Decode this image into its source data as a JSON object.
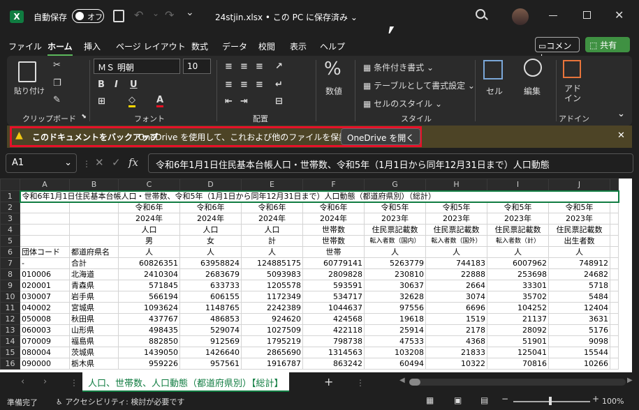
{
  "titlebar": {
    "app_icon": "X",
    "autosave_label": "自動保存",
    "autosave_state": "オフ",
    "file_title": "24stjin.xlsx • この PC に保存済み",
    "chevron": "⌄"
  },
  "menu": [
    "ファイル",
    "ホーム",
    "挿入",
    "ページ レイアウト",
    "数式",
    "データ",
    "校閲",
    "表示",
    "ヘルプ"
  ],
  "menu_active": "ホーム",
  "comment_button": "コメント",
  "share_button": "共有",
  "ribbon": {
    "paste_label": "貼り付け",
    "clipboard_label": "クリップボード",
    "font_name": "ＭＳ 明朝",
    "font_size": "10",
    "font_label": "フォント",
    "align_label": "配置",
    "number_label": "数値",
    "number_symbol": "%",
    "cond_format": "条件付き書式",
    "table_format": "テーブルとして書式設定",
    "cell_style": "セルのスタイル",
    "style_label": "スタイル",
    "cells_label": "セル",
    "edit_label": "編集",
    "addin_btn_1": "アド",
    "addin_btn_2": "イン",
    "addin_label": "アドイン"
  },
  "notification": {
    "title": "このドキュメントをバックアップ",
    "message": "OneDrive を使用して、これおよび他のファイルを保護します。",
    "button": "OneDrive を開く",
    "close": "✕"
  },
  "formula_bar": {
    "cell_ref": "A1",
    "fx": "fx",
    "content": "令和6年1月1日住民基本台帳人口・世帯数、令和5年（1月1日から同年12月31日まで）人口動態"
  },
  "columns": [
    "A",
    "B",
    "C",
    "D",
    "E",
    "F",
    "G",
    "H",
    "I",
    "J"
  ],
  "row_numbers": [
    "1",
    "2",
    "3",
    "4",
    "5",
    "6",
    "7",
    "8",
    "9",
    "10",
    "11",
    "12",
    "13",
    "14",
    "15",
    "16"
  ],
  "row1_text": "令和6年1月1日住民基本台帳人口・世帯数、令和5年（1月1日から同年12月31日まで）人口動態（都道府県別）（総計）",
  "header_rows": {
    "r2": [
      "",
      "",
      "令和6年",
      "令和6年",
      "令和6年",
      "令和6年",
      "令和5年",
      "令和5年",
      "令和5年",
      "令和5年"
    ],
    "r3": [
      "",
      "",
      "2024年",
      "2024年",
      "2024年",
      "2024年",
      "2023年",
      "2023年",
      "2023年",
      "2023年"
    ],
    "r4": [
      "",
      "",
      "人口",
      "人口",
      "人口",
      "世帯数",
      "住民票記載数",
      "住民票記載数",
      "住民票記載数",
      "住民票記載数"
    ],
    "r5": [
      "",
      "",
      "男",
      "女",
      "計",
      "世帯数",
      "転入者数（国内）",
      "転入者数（国外）",
      "転入者数（計）",
      "出生者数"
    ],
    "r6": [
      "団体コード",
      "都道府県名",
      "人",
      "人",
      "人",
      "世帯",
      "人",
      "人",
      "人",
      "人"
    ]
  },
  "data_rows": [
    [
      "-",
      "合計",
      "60826351",
      "63958824",
      "124885175",
      "60779141",
      "5263779",
      "744183",
      "6007962",
      "748912"
    ],
    [
      "010006",
      "北海道",
      "2410304",
      "2683679",
      "5093983",
      "2809828",
      "230810",
      "22888",
      "253698",
      "24682"
    ],
    [
      "020001",
      "青森県",
      "571845",
      "633733",
      "1205578",
      "593591",
      "30637",
      "2664",
      "33301",
      "5718"
    ],
    [
      "030007",
      "岩手県",
      "566194",
      "606155",
      "1172349",
      "534717",
      "32628",
      "3074",
      "35702",
      "5484"
    ],
    [
      "040002",
      "宮城県",
      "1093624",
      "1148765",
      "2242389",
      "1044637",
      "97556",
      "6696",
      "104252",
      "12404"
    ],
    [
      "050008",
      "秋田県",
      "437767",
      "486853",
      "924620",
      "424568",
      "19618",
      "1519",
      "21137",
      "3631"
    ],
    [
      "060003",
      "山形県",
      "498435",
      "529074",
      "1027509",
      "422118",
      "25914",
      "2178",
      "28092",
      "5176"
    ],
    [
      "070009",
      "福島県",
      "882850",
      "912569",
      "1795219",
      "798738",
      "47533",
      "4368",
      "51901",
      "9098"
    ],
    [
      "080004",
      "茨城県",
      "1439050",
      "1426640",
      "2865690",
      "1314563",
      "103208",
      "21833",
      "125041",
      "15544"
    ],
    [
      "090000",
      "栃木県",
      "959226",
      "957561",
      "1916787",
      "863242",
      "60494",
      "10322",
      "70816",
      "10266"
    ]
  ],
  "sheet_tab": "人口、世帯数、人口動態（都道府県別）【総計】",
  "add_sheet": "+",
  "status": {
    "ready": "準備完了",
    "accessibility": "アクセシビリティ: 検討が必要です",
    "zoom": "100%"
  }
}
